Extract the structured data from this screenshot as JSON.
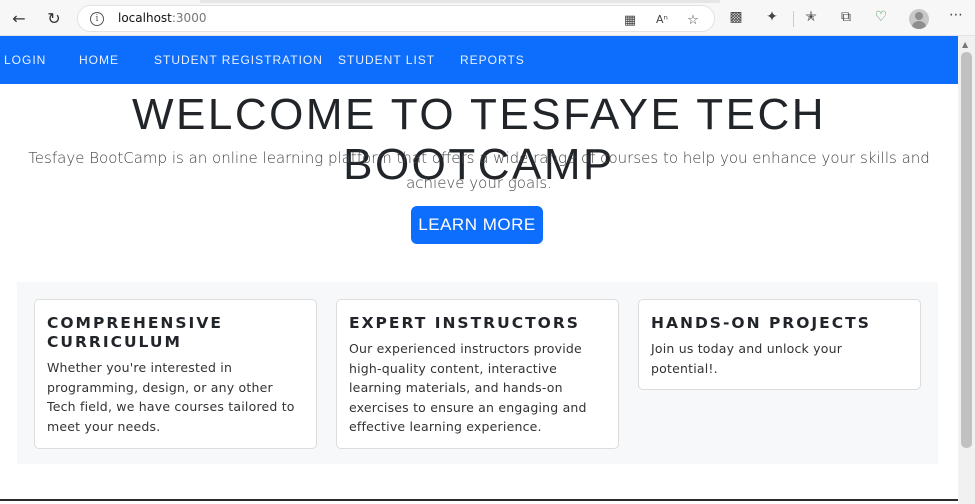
{
  "browser": {
    "url_host": "localhost",
    "url_port": ":3000",
    "icons": [
      "back-icon",
      "refresh-icon",
      "info-icon",
      "split-screen-icon",
      "read-aloud-icon",
      "favorite-star-icon",
      "extension-icon",
      "puzzle-icon",
      "favorites-icon",
      "collections-icon",
      "heart-pulse-icon",
      "profile-avatar-icon",
      "more-menu-icon"
    ]
  },
  "navbar": {
    "items": [
      {
        "label": "LOGIN"
      },
      {
        "label": "HOME"
      },
      {
        "label": "STUDENT REGISTRATION"
      },
      {
        "label": "STUDENT LIST"
      },
      {
        "label": "REPORTS"
      }
    ],
    "color": "#0d6efd"
  },
  "hero": {
    "title": "WELCOME TO TESFAYE TECH BOOTCAMP",
    "subtitle": "Tesfaye BootCamp is an online learning platform that offers a wide range of courses to help you enhance your skills and achieve your goals.",
    "button_label": "LEARN MORE"
  },
  "features": [
    {
      "title": "COMPREHENSIVE CURRICULUM",
      "text": "Whether you're interested in programming, design, or any other Tech field, we have courses tailored to meet your needs."
    },
    {
      "title": "EXPERT INSTRUCTORS",
      "text": "Our experienced instructors provide high-quality content, interactive learning materials, and hands-on exercises to ensure an engaging and effective learning experience."
    },
    {
      "title": "HANDS-ON PROJECTS",
      "text": "Join us today and unlock your potential!."
    }
  ]
}
